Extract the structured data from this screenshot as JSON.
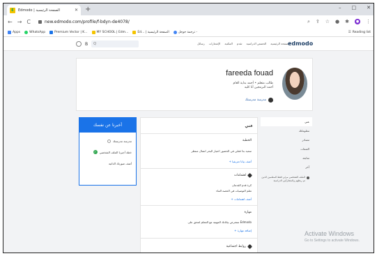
{
  "browser": {
    "tab_title": "Edmodo | الصفحة الرئيسية",
    "tab_close": "✕",
    "new_tab": "+",
    "win_min": "–",
    "win_max": "□",
    "win_close": "✕",
    "back": "←",
    "forward": "→",
    "reload": "C",
    "url": "new.edmodo.com/profile/f-bdyn-de4078/",
    "bookmarks": [
      {
        "label": "Apps",
        "color": "#4285f4"
      },
      {
        "label": "WhatsApp",
        "color": "#25d366"
      },
      {
        "label": "Premium Vector | K...",
        "color": "#1a73e8"
      },
      {
        "label": "MY SCHOOL | Edm...",
        "color": "#f5c400"
      },
      {
        "label": "Ed... | الصفحة الرئيسية",
        "color": "#f5c400"
      },
      {
        "label": "ترجمة جوجل -",
        "color": "#4285f4"
      }
    ],
    "reading_list": "Reading list"
  },
  "edmodo": {
    "search_placeholder": "Q",
    "nav_links": [
      "رسائل",
      "الإشعارات",
      "المكتبة",
      "تقدم",
      "الحصص الدراسية",
      "الصفحة الرئيسية"
    ],
    "logo": "edmodo"
  },
  "profile": {
    "name": "fareeda fouad",
    "role_line1": "طالب متعلم • أجمد بداية العام",
    "role_line2": "أحمد البرمجين أنا كليه",
    "school": "مدرسة مدرستك"
  },
  "about": {
    "header": "أخبرنا عن نفسك",
    "items": [
      {
        "label": "مدرسة مدرستك",
        "icon": "person-icon"
      },
      {
        "label": "خطة أجبرنا الملف الشخصي",
        "icon": "check-icon"
      },
      {
        "label": "أضف صورتك الذاتية",
        "icon": "none"
      }
    ]
  },
  "main": {
    "title": "عني",
    "section1_title": "الخطبة",
    "section1_text": "سعيد بذا فعلي في الحضور اختيار البحر اتصال منتظر",
    "section1_link": "+ أضف بيانا تعريفيا",
    "section2_title": "اهتمامات",
    "section2_text1": "كرة قدم القدمان",
    "section2_text2": "تعلم التوصيات في الحصة الماء",
    "section2_link": "+ أضف اهتمامات",
    "section3_title": "مهارة",
    "section3_text": "ستعرض بياناتك المهنية مع المعلم لمحق على Edmodo",
    "section3_link": "+ إضافة مهارة",
    "section4_title": "روابط اجتماعية"
  },
  "side_nav": {
    "items": [
      "عني",
      "معلوماتك",
      "مصادر",
      "الصفات",
      "متابعة",
      "آخر"
    ],
    "active_index": 0,
    "note": "الملف الشخصي مرئي فقط للمعلمين الذين تم ربطهم والمشاركين الدراسية"
  },
  "watermark": {
    "line1": "Activate Windows",
    "line2": "Go to Settings to activate Windows."
  }
}
